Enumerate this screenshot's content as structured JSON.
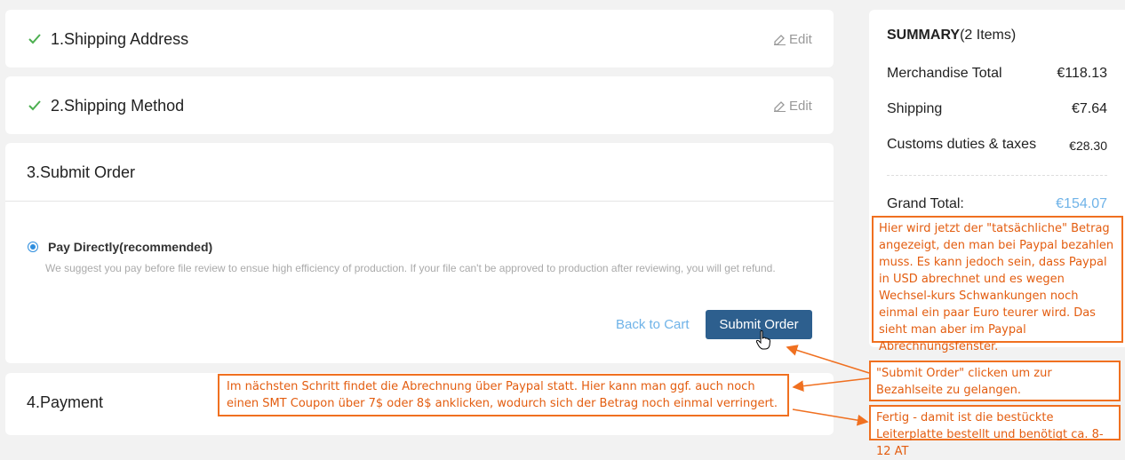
{
  "steps": {
    "shipping_address": {
      "title": "1.Shipping Address",
      "edit": "Edit"
    },
    "shipping_method": {
      "title": "2.Shipping Method",
      "edit": "Edit"
    },
    "submit_order": {
      "title": "3.Submit Order",
      "pay_option": "Pay Directly(recommended)",
      "pay_description": "We suggest you pay before file review to ensue high efficiency of production. If your file can't be approved to production after reviewing, you will get refund.",
      "back_to_cart": "Back to Cart",
      "submit_button": "Submit Order"
    },
    "payment": {
      "title": "4.Payment"
    }
  },
  "summary": {
    "title": "SUMMARY",
    "items_count": "(2 Items)",
    "rows": [
      {
        "label": "Merchandise Total",
        "value": "€118.13"
      },
      {
        "label": "Shipping",
        "value": "€7.64"
      },
      {
        "label": "Customs duties & taxes",
        "value": "€28.30"
      }
    ],
    "grand_total_label": "Grand Total:",
    "grand_total_value": "€154.07"
  },
  "annotations": {
    "amount_note": "Hier wird jetzt der \"tatsächliche\" Betrag angezeigt, den man bei Paypal bezahlen muss. Es kann jedoch sein, dass Paypal in USD abrechnet und es wegen Wechsel-kurs Schwankungen noch einmal ein paar Euro teurer wird. Das sieht man aber im Paypal Abrechnungsfenster.",
    "submit_note": "\"Submit Order\" clicken um zur Bezahlseite zu gelangen.",
    "payment_note": "Im nächsten Schritt findet die Abrechnung über Paypal statt. Hier kann man ggf. auch noch einen SMT Coupon über 7$ oder 8$ anklicken, wodurch sich der Betrag noch einmal verringert.",
    "done_note": "Fertig - damit ist die bestückte Leiterplatte bestellt und benötigt ca. 8-12 AT"
  },
  "colors": {
    "accent_blue": "#2d5f8e",
    "link_blue": "#6fb3e8",
    "check_green": "#4caf50",
    "annotation_orange": "#f07020"
  }
}
